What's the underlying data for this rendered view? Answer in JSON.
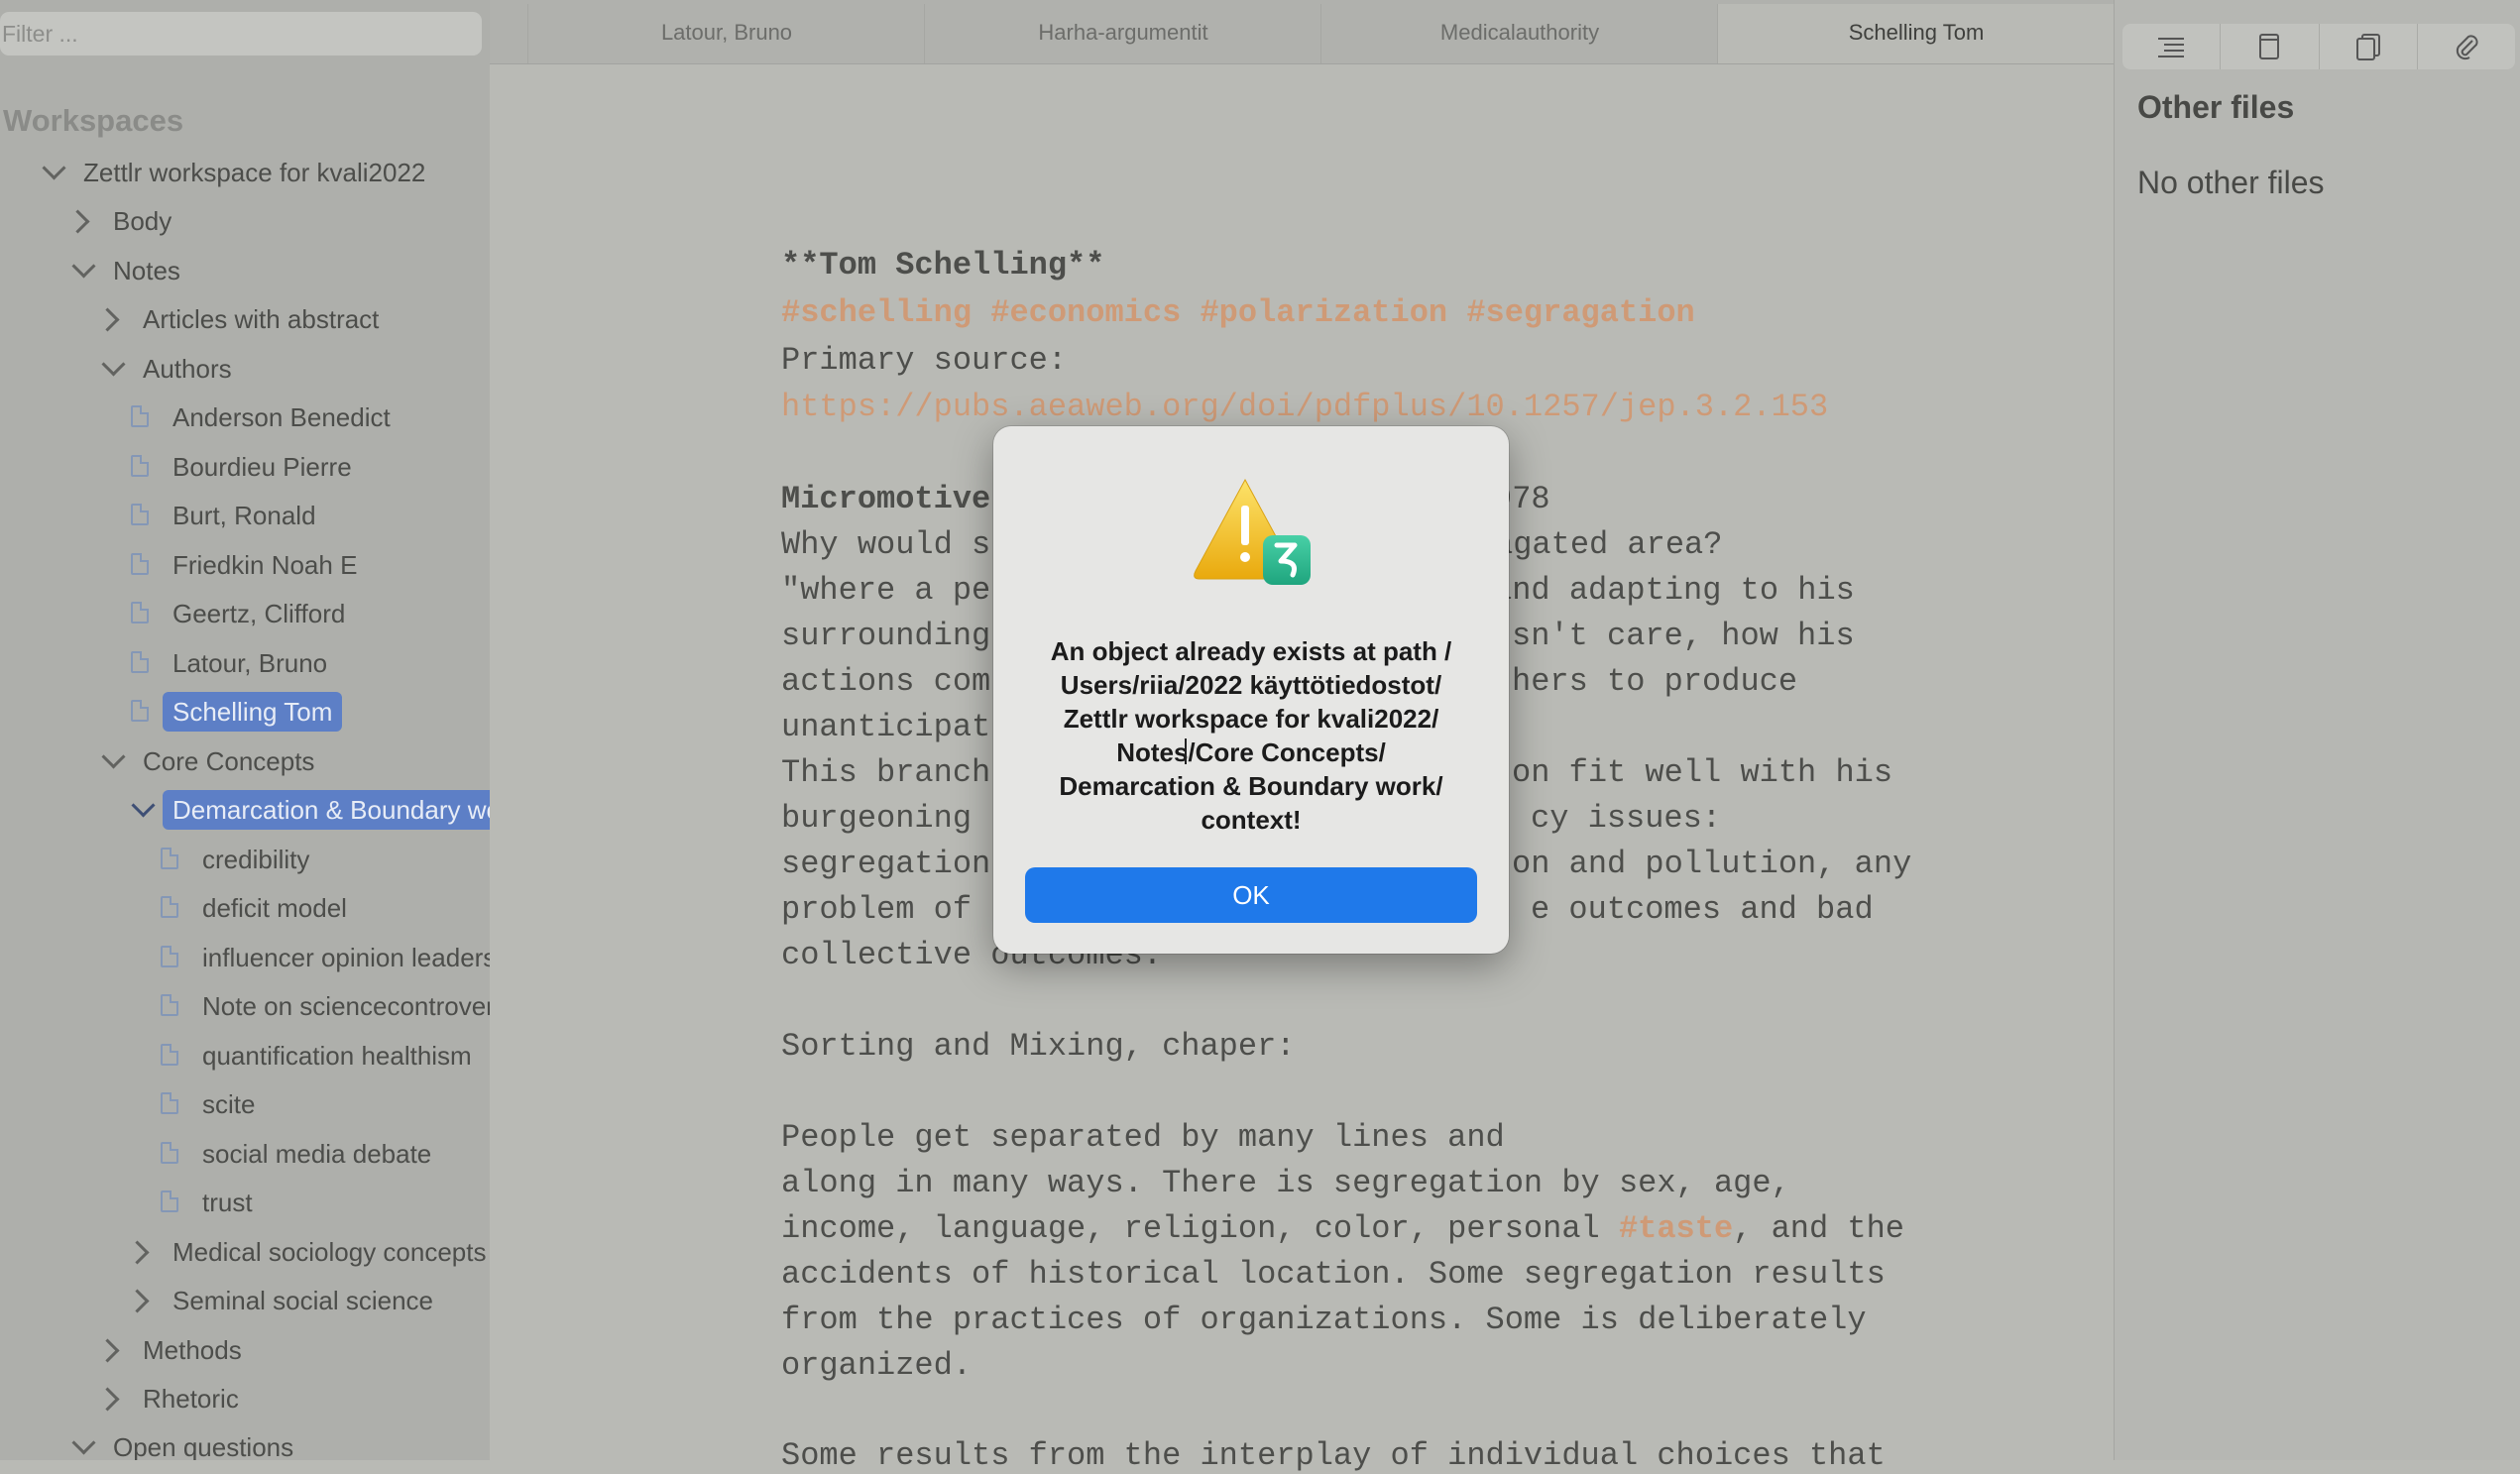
{
  "sidebar": {
    "filter_placeholder": "Filter ...",
    "workspaces_heading": "Workspaces",
    "tree": [
      {
        "label": "Zettlr workspace for kvali2022",
        "kind": "folder-open"
      },
      {
        "label": "Body",
        "kind": "folder-closed"
      },
      {
        "label": "Notes",
        "kind": "folder-open"
      },
      {
        "label": "Articles with abstract",
        "kind": "folder-closed"
      },
      {
        "label": "Authors",
        "kind": "folder-open"
      },
      {
        "label": "Anderson Benedict",
        "kind": "file"
      },
      {
        "label": "Bourdieu Pierre",
        "kind": "file"
      },
      {
        "label": "Burt, Ronald",
        "kind": "file"
      },
      {
        "label": "Friedkin Noah E",
        "kind": "file"
      },
      {
        "label": "Geertz, Clifford",
        "kind": "file"
      },
      {
        "label": "Latour, Bruno",
        "kind": "file"
      },
      {
        "label": "Schelling Tom",
        "kind": "file",
        "selected": true
      },
      {
        "label": "Core Concepts",
        "kind": "folder-open"
      },
      {
        "label": "Demarcation & Boundary work",
        "kind": "folder-open",
        "selected": true
      },
      {
        "label": "credibility",
        "kind": "file"
      },
      {
        "label": "deficit model",
        "kind": "file"
      },
      {
        "label": "influencer opinion leaders",
        "kind": "file"
      },
      {
        "label": "Note on sciencecontroversies",
        "kind": "file"
      },
      {
        "label": "quantification healthism",
        "kind": "file"
      },
      {
        "label": "scite",
        "kind": "file"
      },
      {
        "label": "social media debate",
        "kind": "file"
      },
      {
        "label": "trust",
        "kind": "file"
      },
      {
        "label": "Medical sociology concepts",
        "kind": "folder-closed"
      },
      {
        "label": "Seminal social science",
        "kind": "folder-closed"
      },
      {
        "label": "Methods",
        "kind": "folder-closed"
      },
      {
        "label": "Rhetoric",
        "kind": "folder-closed"
      },
      {
        "label": "Open questions",
        "kind": "folder-open"
      }
    ]
  },
  "tabs": [
    {
      "label": "Latour, Bruno"
    },
    {
      "label": "Harha-argumentit"
    },
    {
      "label": "Medicalauthority"
    },
    {
      "label": "Schelling Tom",
      "active": true
    }
  ],
  "editor": {
    "title": "**Tom Schelling**",
    "tags": "#schelling #economics #polarization #segragation",
    "primary_source_label": "Primary source:",
    "primary_source_url": "https://pubs.aeaweb.org/doi/pdfplus/10.1257/jep.3.2.153",
    "micromotives_left": "Micromotive",
    "micromotives_right": "978",
    "line_why_left": "Why would s",
    "line_why_right": "agated area?",
    "line_where_left": "\"where a pe",
    "line_where_right": "and adapting to his",
    "line_surround_left": "surrounding",
    "line_surround_right": "sn't care, how his",
    "line_actions_left": "actions com",
    "line_actions_right": "hers to produce",
    "line_unanticipated": "unanticipat",
    "line_branch_left": "This branch",
    "line_branch_right": "on fit well with his",
    "line_burgeoning_left": "burgeoning",
    "line_burgeoning_right": "cy issues:",
    "line_segregation_left": "segregation",
    "line_segregation_right": "on and pollution, any",
    "line_problem_left": "problem of",
    "line_problem_right": "e outcomes and bad",
    "line_collective": "collective outcomes.",
    "sorting_heading": "Sorting and Mixing, chaper:",
    "para_1": "People get separated by many lines and",
    "para_2": "along in many ways. There is segregation by sex, age,",
    "para_3_a": "income, language, religion, color, personal ",
    "para_3_tag": "#taste",
    "para_3_b": ", and the",
    "para_4": "accidents of historical location. Some segregation results",
    "para_5": "from the practices of organizations. Some is deliberately",
    "para_6": "organized.",
    "para_7": "Some results from the interplay of individual choices that"
  },
  "right_panel": {
    "toolbar_icons": [
      "toc-icon",
      "file-icon",
      "copy-icon",
      "paperclip-icon"
    ],
    "title": "Other files",
    "empty_text": "No other files"
  },
  "dialog": {
    "icon": "warning-icon",
    "message": "An object already exists at path /Users/riia/2022 käyttötiedostot/Zettlr workspace for kvali2022/Notes/Core Concepts/Demarcation & Boundary work/context!",
    "message_lines": [
      "An object already exists at path /",
      "Users/riia/2022 käyttötiedostot/",
      "Zettlr workspace for kvali2022/",
      "Notes/Core Concepts/",
      "Demarcation & Boundary work/",
      "context!"
    ],
    "ok_label": "OK"
  },
  "colors": {
    "accent": "#1f79ea",
    "selection": "#5d7fc6",
    "tag": "#cf9a76"
  }
}
